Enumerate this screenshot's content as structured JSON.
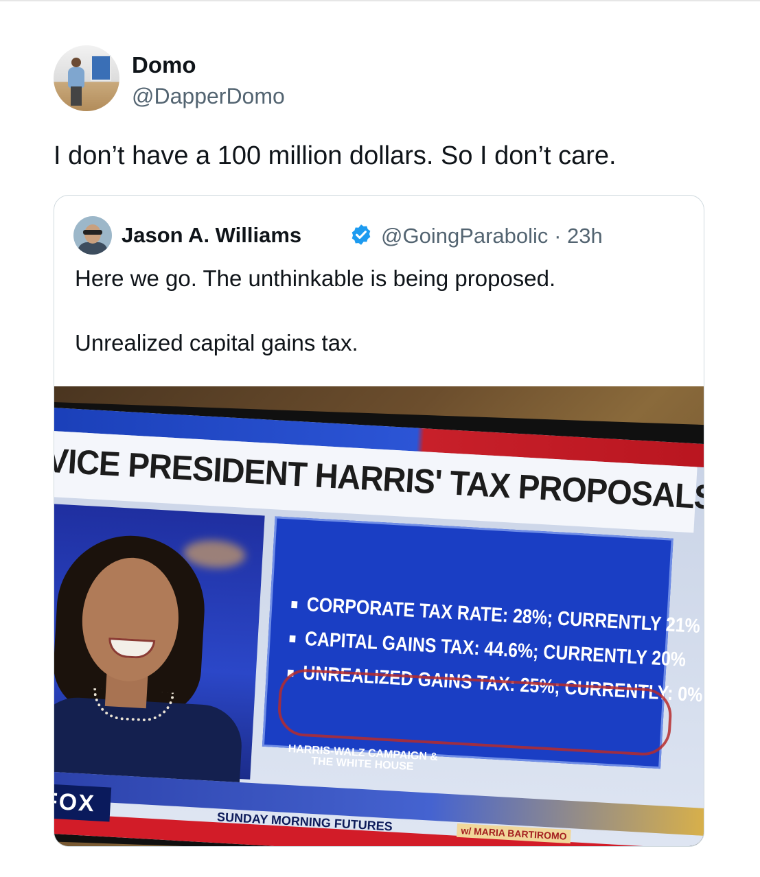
{
  "post": {
    "author_name": "Domo",
    "author_handle": "@DapperDomo",
    "text": "I don’t have a 100 million dollars. So I don’t care."
  },
  "quoted_post": {
    "author_name": "Jason A. Williams",
    "author_handle": "@GoingParabolic",
    "separator": "·",
    "time": "23h",
    "line1": "Here we go. The unthinkable is being proposed.",
    "line2": "Unrealized capital gains tax.",
    "media": {
      "headline": "VICE PRESIDENT HARRIS' TAX PROPOSALS",
      "bullets": [
        "CORPORATE TAX RATE: 28%; CURRENTLY 21%",
        "CAPITAL GAINS TAX: 44.6%; CURRENTLY 20%",
        "UNREALIZED GAINS TAX: 25%; CURRENTLY: 0%"
      ],
      "source_line1": "HARRIS-WALZ CAMPAIGN &",
      "source_line2": "THE WHITE HOUSE",
      "ticker": "SUNDAY MORNING FUTURES",
      "ticker_host": "w/ MARIA BARTIROMO",
      "network_logo": "FOX"
    }
  },
  "colors": {
    "text_primary": "#0f1419",
    "text_secondary": "#536471",
    "verified_blue": "#1d9bf0",
    "card_border": "#cfd9de"
  }
}
